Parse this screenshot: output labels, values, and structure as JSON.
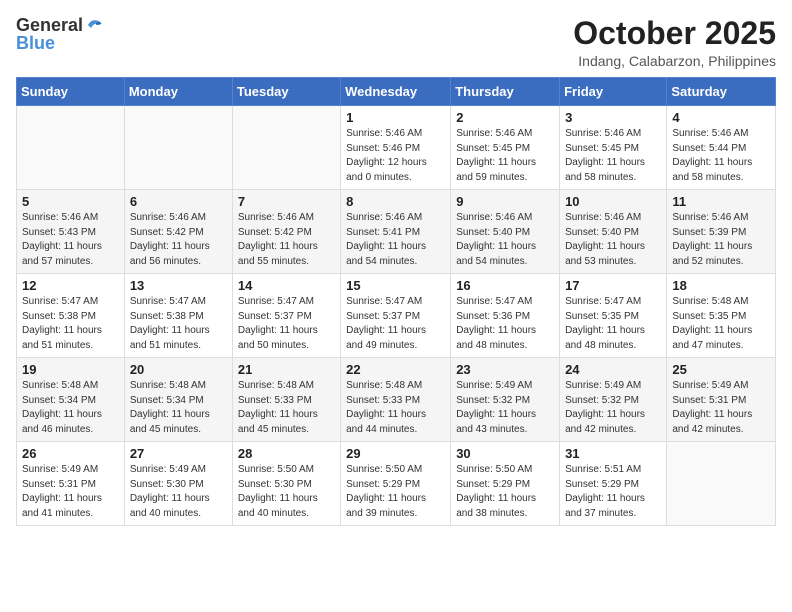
{
  "header": {
    "logo_general": "General",
    "logo_blue": "Blue",
    "month_title": "October 2025",
    "location": "Indang, Calabarzon, Philippines"
  },
  "days_of_week": [
    "Sunday",
    "Monday",
    "Tuesday",
    "Wednesday",
    "Thursday",
    "Friday",
    "Saturday"
  ],
  "weeks": [
    [
      {
        "day": "",
        "info": ""
      },
      {
        "day": "",
        "info": ""
      },
      {
        "day": "",
        "info": ""
      },
      {
        "day": "1",
        "info": "Sunrise: 5:46 AM\nSunset: 5:46 PM\nDaylight: 12 hours\nand 0 minutes."
      },
      {
        "day": "2",
        "info": "Sunrise: 5:46 AM\nSunset: 5:45 PM\nDaylight: 11 hours\nand 59 minutes."
      },
      {
        "day": "3",
        "info": "Sunrise: 5:46 AM\nSunset: 5:45 PM\nDaylight: 11 hours\nand 58 minutes."
      },
      {
        "day": "4",
        "info": "Sunrise: 5:46 AM\nSunset: 5:44 PM\nDaylight: 11 hours\nand 58 minutes."
      }
    ],
    [
      {
        "day": "5",
        "info": "Sunrise: 5:46 AM\nSunset: 5:43 PM\nDaylight: 11 hours\nand 57 minutes."
      },
      {
        "day": "6",
        "info": "Sunrise: 5:46 AM\nSunset: 5:42 PM\nDaylight: 11 hours\nand 56 minutes."
      },
      {
        "day": "7",
        "info": "Sunrise: 5:46 AM\nSunset: 5:42 PM\nDaylight: 11 hours\nand 55 minutes."
      },
      {
        "day": "8",
        "info": "Sunrise: 5:46 AM\nSunset: 5:41 PM\nDaylight: 11 hours\nand 54 minutes."
      },
      {
        "day": "9",
        "info": "Sunrise: 5:46 AM\nSunset: 5:40 PM\nDaylight: 11 hours\nand 54 minutes."
      },
      {
        "day": "10",
        "info": "Sunrise: 5:46 AM\nSunset: 5:40 PM\nDaylight: 11 hours\nand 53 minutes."
      },
      {
        "day": "11",
        "info": "Sunrise: 5:46 AM\nSunset: 5:39 PM\nDaylight: 11 hours\nand 52 minutes."
      }
    ],
    [
      {
        "day": "12",
        "info": "Sunrise: 5:47 AM\nSunset: 5:38 PM\nDaylight: 11 hours\nand 51 minutes."
      },
      {
        "day": "13",
        "info": "Sunrise: 5:47 AM\nSunset: 5:38 PM\nDaylight: 11 hours\nand 51 minutes."
      },
      {
        "day": "14",
        "info": "Sunrise: 5:47 AM\nSunset: 5:37 PM\nDaylight: 11 hours\nand 50 minutes."
      },
      {
        "day": "15",
        "info": "Sunrise: 5:47 AM\nSunset: 5:37 PM\nDaylight: 11 hours\nand 49 minutes."
      },
      {
        "day": "16",
        "info": "Sunrise: 5:47 AM\nSunset: 5:36 PM\nDaylight: 11 hours\nand 48 minutes."
      },
      {
        "day": "17",
        "info": "Sunrise: 5:47 AM\nSunset: 5:35 PM\nDaylight: 11 hours\nand 48 minutes."
      },
      {
        "day": "18",
        "info": "Sunrise: 5:48 AM\nSunset: 5:35 PM\nDaylight: 11 hours\nand 47 minutes."
      }
    ],
    [
      {
        "day": "19",
        "info": "Sunrise: 5:48 AM\nSunset: 5:34 PM\nDaylight: 11 hours\nand 46 minutes."
      },
      {
        "day": "20",
        "info": "Sunrise: 5:48 AM\nSunset: 5:34 PM\nDaylight: 11 hours\nand 45 minutes."
      },
      {
        "day": "21",
        "info": "Sunrise: 5:48 AM\nSunset: 5:33 PM\nDaylight: 11 hours\nand 45 minutes."
      },
      {
        "day": "22",
        "info": "Sunrise: 5:48 AM\nSunset: 5:33 PM\nDaylight: 11 hours\nand 44 minutes."
      },
      {
        "day": "23",
        "info": "Sunrise: 5:49 AM\nSunset: 5:32 PM\nDaylight: 11 hours\nand 43 minutes."
      },
      {
        "day": "24",
        "info": "Sunrise: 5:49 AM\nSunset: 5:32 PM\nDaylight: 11 hours\nand 42 minutes."
      },
      {
        "day": "25",
        "info": "Sunrise: 5:49 AM\nSunset: 5:31 PM\nDaylight: 11 hours\nand 42 minutes."
      }
    ],
    [
      {
        "day": "26",
        "info": "Sunrise: 5:49 AM\nSunset: 5:31 PM\nDaylight: 11 hours\nand 41 minutes."
      },
      {
        "day": "27",
        "info": "Sunrise: 5:49 AM\nSunset: 5:30 PM\nDaylight: 11 hours\nand 40 minutes."
      },
      {
        "day": "28",
        "info": "Sunrise: 5:50 AM\nSunset: 5:30 PM\nDaylight: 11 hours\nand 40 minutes."
      },
      {
        "day": "29",
        "info": "Sunrise: 5:50 AM\nSunset: 5:29 PM\nDaylight: 11 hours\nand 39 minutes."
      },
      {
        "day": "30",
        "info": "Sunrise: 5:50 AM\nSunset: 5:29 PM\nDaylight: 11 hours\nand 38 minutes."
      },
      {
        "day": "31",
        "info": "Sunrise: 5:51 AM\nSunset: 5:29 PM\nDaylight: 11 hours\nand 37 minutes."
      },
      {
        "day": "",
        "info": ""
      }
    ]
  ]
}
